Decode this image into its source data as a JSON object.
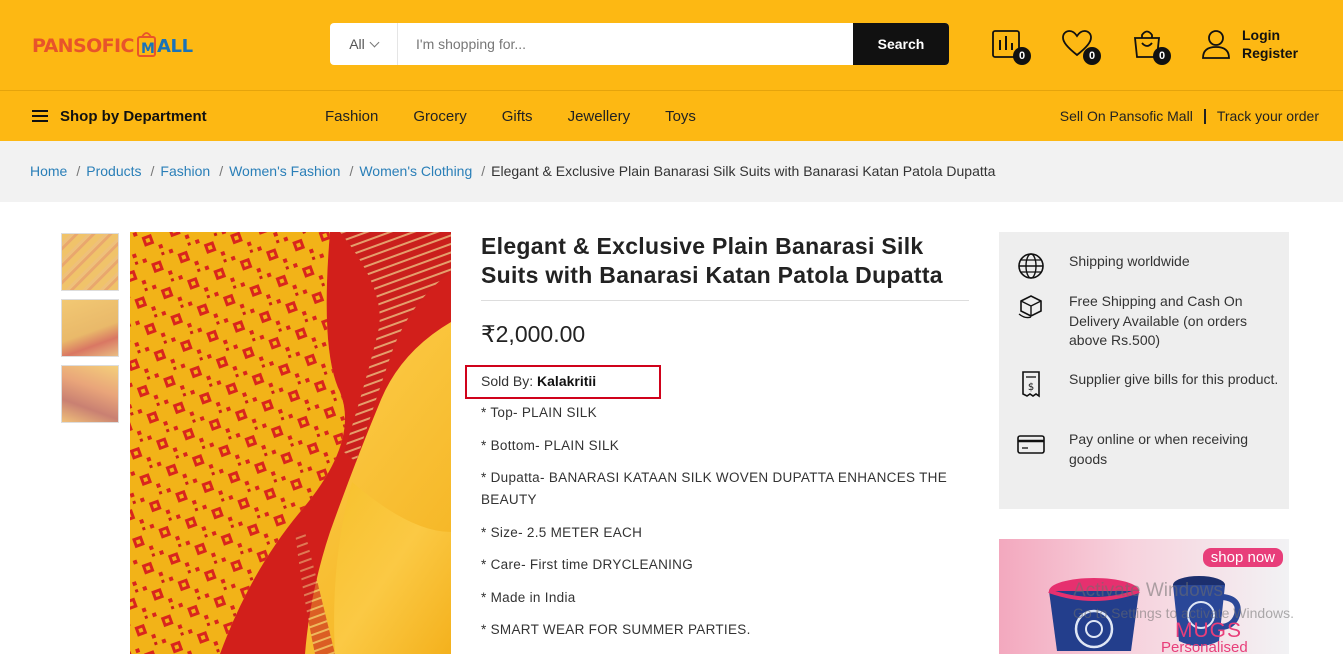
{
  "header": {
    "logo_text": "PANSOFIC MALL",
    "search": {
      "category": "All",
      "placeholder": "I'm shopping for...",
      "button_label": "Search"
    },
    "compare_count": "0",
    "wishlist_count": "0",
    "cart_count": "0",
    "login_label": "Login",
    "register_label": "Register",
    "colors": {
      "brand_yellow": "#fdb813",
      "dark": "#111111"
    }
  },
  "nav": {
    "department_label": "Shop by Department",
    "links": [
      "Fashion",
      "Grocery",
      "Gifts",
      "Jewellery",
      "Toys"
    ],
    "sell_label": "Sell On Pansofic Mall",
    "track_label": "Track your order"
  },
  "breadcrumb": {
    "items": [
      "Home",
      "Products",
      "Fashion",
      "Women's Fashion",
      "Women's Clothing"
    ],
    "current": "Elegant & Exclusive Plain Banarasi Silk Suits with Banarasi Katan Patola Dupatta",
    "separator": "/"
  },
  "product": {
    "title": "Elegant & Exclusive Plain Banarasi Silk Suits with Banarasi Katan Patola Dupatta",
    "price": "₹2,000.00",
    "sold_by_label": "Sold By:",
    "seller": "Kalakritii",
    "features": [
      "* Top- PLAIN SILK",
      "* Bottom- PLAIN SILK",
      "* Dupatta- BANARASI KATAAN SILK WOVEN DUPATTA ENHANCES THE BEAUTY",
      "* Size- 2.5 METER EACH",
      "* Care- First time DRYCLEANING",
      "* Made in India",
      "* SMART WEAR FOR SUMMER PARTIES."
    ],
    "highlight_color": "#d0021b"
  },
  "info": {
    "items": [
      {
        "icon": "globe-icon",
        "text": "Shipping worldwide"
      },
      {
        "icon": "box-icon",
        "text": "Free Shipping and Cash On Delivery Available (on orders above Rs.500)"
      },
      {
        "icon": "bill-icon",
        "text": "Supplier give bills for this product."
      },
      {
        "icon": "card-icon",
        "text": "Pay online or when receiving goods"
      }
    ]
  },
  "promo": {
    "shop_now": "shop now",
    "title": "MUGS",
    "subtitle": "Personalised"
  },
  "watermark": {
    "line1": "Activate Windows",
    "line2": "Go to Settings to activate Windows."
  }
}
